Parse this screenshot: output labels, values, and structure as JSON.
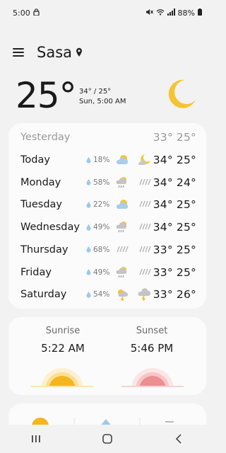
{
  "status_bar": {
    "time": "5:00",
    "battery": "88%",
    "icons": [
      "lock-icon",
      "mute-icon",
      "wifi-icon",
      "signal-icon",
      "battery-icon"
    ]
  },
  "header": {
    "city": "Sasa",
    "icons": [
      "menu-icon",
      "location-pin-icon"
    ]
  },
  "current": {
    "temperature": "25°",
    "high_low": "34° / 25°",
    "datetime": "Sun, 5:00 AM",
    "condition_icon": "crescent-moon-icon"
  },
  "forecast": {
    "yesterday": {
      "day": "Yesterday",
      "temps": "33° 25°"
    },
    "days": [
      {
        "day": "Today",
        "precip": "18%",
        "day_icon": "partly-cloudy-day-icon",
        "night_icon": "moon-cloud-icon",
        "temps": "34° 25°"
      },
      {
        "day": "Monday",
        "precip": "58%",
        "day_icon": "cloud-rain-icon",
        "night_icon": "rain-icon",
        "temps": "34° 24°"
      },
      {
        "day": "Tuesday",
        "precip": "22%",
        "day_icon": "partly-cloudy-day-icon",
        "night_icon": "rain-icon",
        "temps": "34° 25°"
      },
      {
        "day": "Wednesday",
        "precip": "49%",
        "day_icon": "cloud-rain-icon",
        "night_icon": "rain-icon",
        "temps": "34° 25°"
      },
      {
        "day": "Thursday",
        "precip": "68%",
        "day_icon": "rain-icon",
        "night_icon": "rain-icon",
        "temps": "33° 25°"
      },
      {
        "day": "Friday",
        "precip": "49%",
        "day_icon": "cloud-rain-icon",
        "night_icon": "rain-icon",
        "temps": "33° 25°"
      },
      {
        "day": "Saturday",
        "precip": "54%",
        "day_icon": "thunderstorm-sun-icon",
        "night_icon": "thunderstorm-icon",
        "temps": "33° 26°"
      }
    ]
  },
  "sun": {
    "sunrise_label": "Sunrise",
    "sunrise_time": "5:22 AM",
    "sunset_label": "Sunset",
    "sunset_time": "5:46 PM"
  },
  "colors": {
    "moon": "#f5c431",
    "sunrise": "#f5b51c",
    "sunset": "#ec8f8f",
    "drop": "#9ec9ee"
  }
}
